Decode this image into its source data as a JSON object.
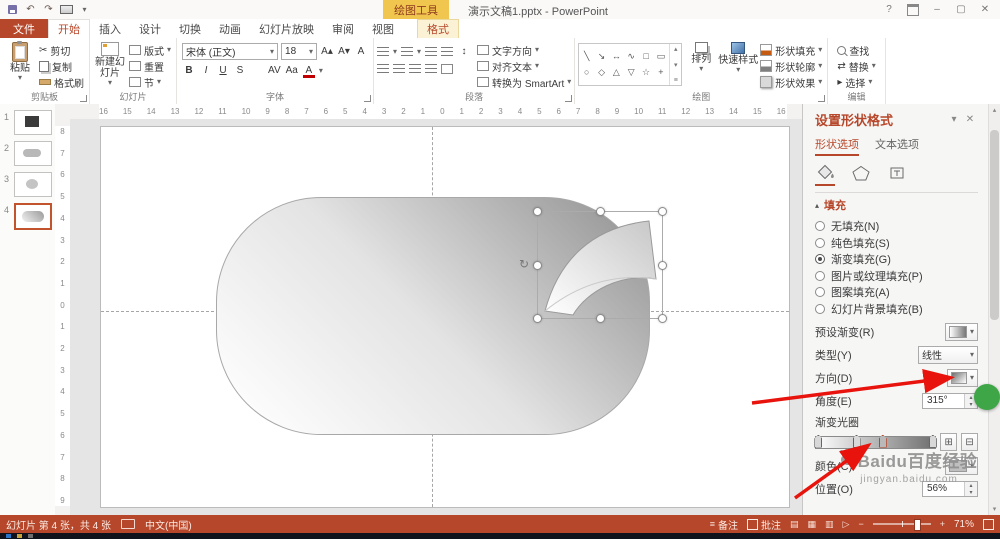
{
  "colors": {
    "accent": "#B7472A",
    "context_tab_bg": "#F1C64F",
    "statusbar_bg": "#B7472A",
    "arrow_annotation": "#E8130C",
    "badge_green": "#3EA647"
  },
  "titlebar": {
    "context_tool": "绘图工具",
    "title": "演示文稿1.pptx - PowerPoint",
    "help": "?"
  },
  "tabs": {
    "file": "文件",
    "home": "开始",
    "others": [
      "插入",
      "设计",
      "切换",
      "动画",
      "幻灯片放映",
      "审阅",
      "视图"
    ],
    "context": "格式"
  },
  "ribbon": {
    "clipboard": {
      "label": "剪贴板",
      "paste": "粘贴",
      "cut": "剪切",
      "copy": "复制",
      "format_painter": "格式刷"
    },
    "slides": {
      "label": "幻灯片",
      "new_slide": "新建幻灯片",
      "layout": "版式",
      "reset": "重置",
      "section": "节"
    },
    "font": {
      "label": "字体",
      "name": "宋体 (正文)",
      "size": "18"
    },
    "paragraph": {
      "label": "段落",
      "text_direction": "文字方向",
      "align_text": "对齐文本",
      "smartart": "转换为 SmartArt"
    },
    "drawing": {
      "label": "绘图",
      "arrange": "排列",
      "quick_styles": "快速样式",
      "fill": "形状填充",
      "outline": "形状轮廓",
      "effects": "形状效果"
    },
    "editing": {
      "label": "编辑",
      "find": "查找",
      "replace": "替换",
      "select": "选择"
    }
  },
  "slide_panel": {
    "slides": [
      {
        "num": "1"
      },
      {
        "num": "2"
      },
      {
        "num": "3"
      },
      {
        "num": "4"
      }
    ],
    "current": "4"
  },
  "rulers": {
    "horizontal": [
      "16",
      "15",
      "14",
      "13",
      "12",
      "11",
      "10",
      "9",
      "8",
      "7",
      "6",
      "5",
      "4",
      "3",
      "2",
      "1",
      "0",
      "1",
      "2",
      "3",
      "4",
      "5",
      "6",
      "7",
      "8",
      "9",
      "10",
      "11",
      "12",
      "13",
      "14",
      "15",
      "16"
    ],
    "vertical": [
      "8",
      "7",
      "6",
      "5",
      "4",
      "3",
      "2",
      "1",
      "0",
      "1",
      "2",
      "3",
      "4",
      "5",
      "6",
      "7",
      "8",
      "9"
    ]
  },
  "format_panel": {
    "title": "设置形状格式",
    "tab_shape": "形状选项",
    "tab_text": "文本选项",
    "section_fill": "填充",
    "fill_options": [
      {
        "label": "无填充(N)",
        "selected": false
      },
      {
        "label": "纯色填充(S)",
        "selected": false
      },
      {
        "label": "渐变填充(G)",
        "selected": true
      },
      {
        "label": "图片或纹理填充(P)",
        "selected": false
      },
      {
        "label": "图案填充(A)",
        "selected": false
      },
      {
        "label": "幻灯片背景填充(B)",
        "selected": false
      }
    ],
    "preset_label": "预设渐变(R)",
    "type_label": "类型(Y)",
    "type_value": "线性",
    "direction_label": "方向(D)",
    "angle_label": "角度(E)",
    "angle_value": "315°",
    "stops_label": "渐变光圈",
    "stop_positions": [
      2,
      34,
      56,
      98
    ],
    "color_label": "颜色(C)",
    "position_label": "位置(O)",
    "position_value": "56%"
  },
  "statusbar": {
    "slide_info": "幻灯片 第 4 张，共 4 张",
    "language": "中文(中国)",
    "notes": "备注",
    "comments": "批注",
    "zoom": "71%"
  },
  "watermark": {
    "line1": "Baidu百度经验",
    "line2": "jingyan.baidu.com"
  },
  "icons": {
    "caret_down": "▾",
    "caret_up": "▴",
    "undo": "↶",
    "redo": "↷",
    "minimize": "–",
    "maximize": "▢",
    "close": "✕",
    "cut": "✂",
    "grow_font": "A▴",
    "shrink_font": "A▾",
    "bold": "B",
    "italic": "I",
    "underline": "U",
    "shadow": "S",
    "char_spacing": "AV",
    "change_case": "Aa",
    "font_color": "A",
    "line_spacing": "↕",
    "replace_arrows": "⇄",
    "select_cursor": "▸",
    "rotate": "↻",
    "shapes": [
      "╲",
      "↘",
      "↔",
      "∿",
      "□",
      "▭",
      "○",
      "◇",
      "△",
      "▽",
      "☆",
      "+"
    ],
    "add_stop": "⊞",
    "remove_stop": "⊟",
    "view_normal": "▤",
    "view_sorter": "▦",
    "view_reading": "▥",
    "view_slideshow": "▷",
    "notes_lines": "≡",
    "zoom_minus": "−",
    "zoom_plus": "+"
  }
}
